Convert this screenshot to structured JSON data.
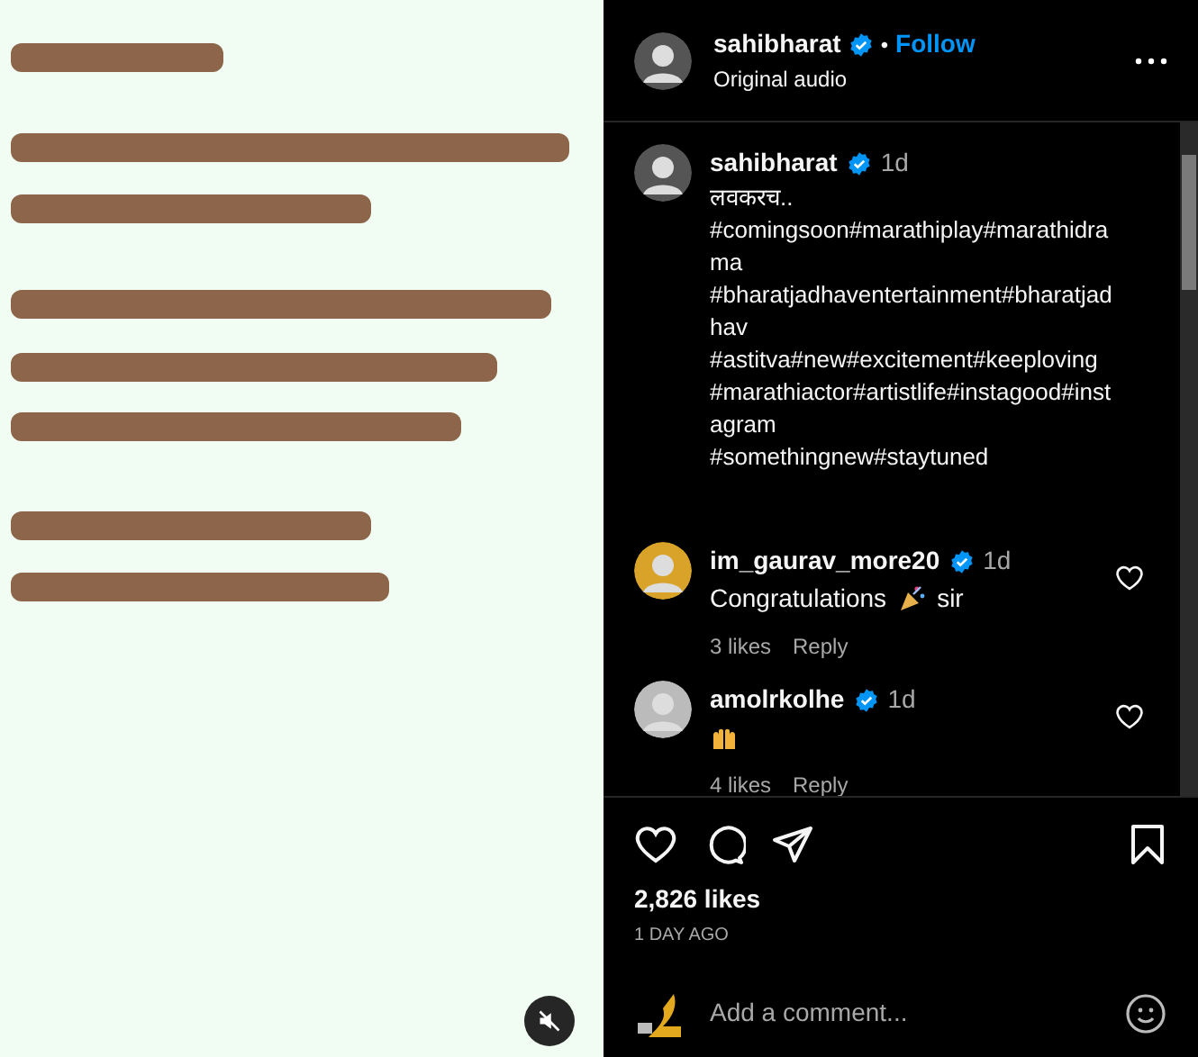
{
  "media": {
    "kind": "picture",
    "muted": true
  },
  "header": {
    "username": "sahibharat",
    "verified": true,
    "separator": "•",
    "follow": "Follow",
    "audio": "Original audio"
  },
  "caption": {
    "username": "sahibharat",
    "verified": true,
    "time": "1d",
    "lines": [
      "लवकरच..",
      "#comingsoon#marathiplay#marathidra",
      "ma",
      "#bharatjadhaventertainment#bharatjad",
      "hav",
      "#astitva#new#excitement#keeploving",
      "#marathiactor#artistlife#instagood#inst",
      "agram",
      "#somethingnew#staytuned"
    ]
  },
  "comments": [
    {
      "username": "im_gaurav_more20",
      "verified": true,
      "time": "1d",
      "text_parts": [
        "Congratulations",
        "sir"
      ],
      "likes": "3 likes",
      "reply": "Reply",
      "liked": false
    },
    {
      "username": "amolrkolhe",
      "verified": true,
      "time": "1d",
      "likes": "4 likes",
      "reply": "Reply",
      "liked": false
    }
  ],
  "actions": {
    "liked": false,
    "saved": false
  },
  "likes": "2,826 likes",
  "date": "1 DAY AGO",
  "comment_field": {
    "placeholder": "Add a comment..."
  }
}
